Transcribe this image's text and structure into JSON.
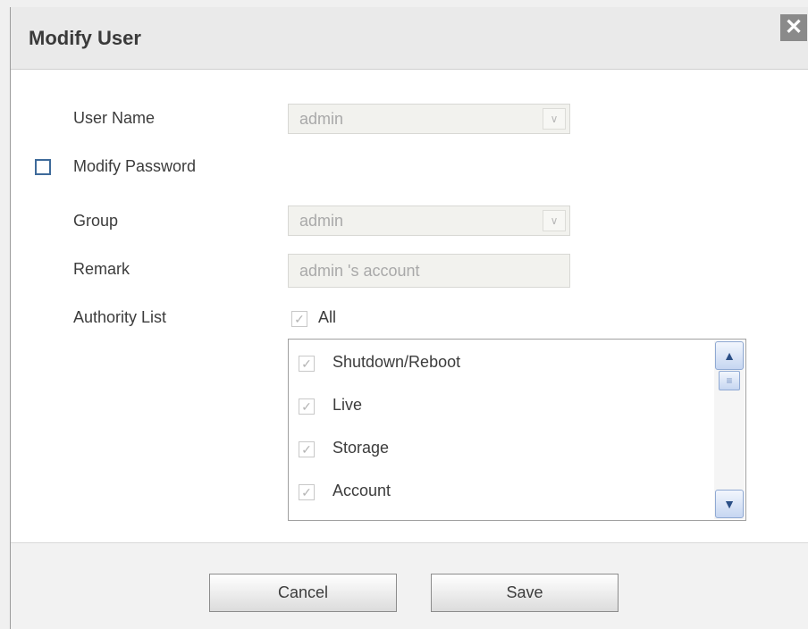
{
  "dialog": {
    "title": "Modify User",
    "close_glyph": "✕"
  },
  "form": {
    "user_name_label": "User Name",
    "user_name_value": "admin",
    "modify_password_label": "Modify Password",
    "modify_password_checked": false,
    "group_label": "Group",
    "group_value": "admin",
    "remark_label": "Remark",
    "remark_value": "admin 's account",
    "authority_list_label": "Authority List",
    "all_label": "All",
    "all_checked": true
  },
  "authority_items": [
    {
      "label": "Shutdown/Reboot",
      "checked": true
    },
    {
      "label": "Live",
      "checked": true
    },
    {
      "label": "Storage",
      "checked": true
    },
    {
      "label": "Account",
      "checked": true
    }
  ],
  "scrollbar": {
    "up_glyph": "▲",
    "down_glyph": "▼",
    "thumb_glyph": "≡"
  },
  "icons": {
    "dropdown_arrow": "chevron-down-icon",
    "check": "check-icon"
  },
  "buttons": {
    "cancel_label": "Cancel",
    "save_label": "Save"
  },
  "colors": {
    "title_bar": "#eaeaea",
    "checkbox_border": "#3e6a9a",
    "disabled_field_bg": "#f2f2ee",
    "disabled_text": "#a9a9a9"
  }
}
